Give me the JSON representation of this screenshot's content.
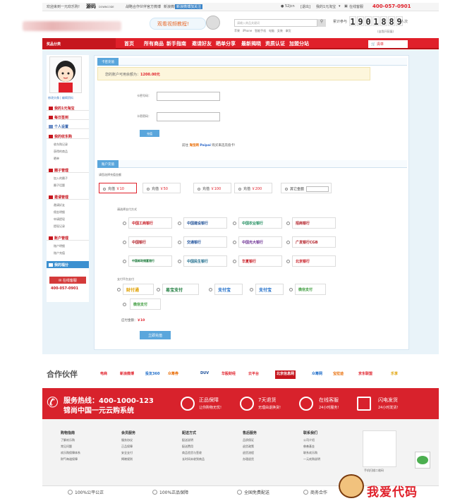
{
  "topbar": {
    "welcome": "欢迎来到一元欢乐购!",
    "brand": "源码",
    "brand_sub": "DOWNCODE",
    "links": [
      "战略合作伙伴",
      "官方微博",
      "新浪微博"
    ],
    "weibo_btn": "新浪微博加关注",
    "user": "52jcn",
    "logout": "[退出]",
    "mine": "我的1元淘宝",
    "service": "在线客服",
    "phone": "400-057-0901"
  },
  "header": {
    "promo": "观看视频教程!",
    "search_placeholder": "请输入商品关键词",
    "hotwords": [
      "苹果",
      "iPhone",
      "智能手机",
      "电脑",
      "女装",
      "拿货"
    ],
    "counter_label": "累计参与",
    "counter_digits": [
      "1",
      "9",
      "0",
      "1",
      "8",
      "8",
      "9"
    ],
    "counter_unit": "人次",
    "counter_note": "(自我开获展)"
  },
  "nav": {
    "category": "奖品分类",
    "items": [
      "首页",
      "所有商品",
      "新手指南",
      "邀请好友",
      "晒单分享",
      "最新揭晓",
      "资质认证",
      "加盟分站"
    ],
    "cart": "清单"
  },
  "sidebar": {
    "avatar_links": [
      "修改头像",
      "编辑资料"
    ],
    "sections": [
      {
        "label": "我的1元淘宝",
        "subs": []
      },
      {
        "label": "每日签到",
        "subs": []
      },
      {
        "label": "个人设置",
        "subs": []
      },
      {
        "label": "我的收东购",
        "subs": [
          "收东购记录",
          "获得的商品",
          "晒单"
        ]
      },
      {
        "label": "圈子管理",
        "subs": [
          "加入的圈子",
          "圈子话题"
        ]
      },
      {
        "label": "邀请管理",
        "subs": [
          "邀请好友",
          "佣金明细",
          "申请提现",
          "提现记录"
        ]
      },
      {
        "label": "账户管理",
        "subs": [
          "账户明细",
          "账户充值"
        ]
      }
    ],
    "active": "我的福分",
    "service_btn": "在线客服",
    "phone": "400-057-0901"
  },
  "card_recharge": {
    "tab": "卡密充值",
    "balance_label": "您的账户可用余额为：",
    "balance_value": "1200.00元",
    "card_no_label": "卡密号码：",
    "card_pwd_label": "卡密密码：",
    "submit": "充值",
    "tip_prefix": "前往",
    "tip_taobao": "淘宝网",
    "tip_paipai": "Paipai",
    "tip_suffix": "购买来选充值卡!"
  },
  "account_recharge": {
    "tab": "账户充值",
    "amount_label": "请您选择充值金额",
    "amounts": [
      {
        "label": "充值",
        "value": "￥10"
      },
      {
        "label": "充值",
        "value": "￥50"
      },
      {
        "label": "充值",
        "value": "￥100"
      },
      {
        "label": "充值",
        "value": "￥200"
      },
      {
        "label": "其它金额",
        "value": ""
      }
    ],
    "pay_method_label": "请选择支付方式",
    "banks": [
      "中国工商银行",
      "中国建设银行",
      "中国农业银行",
      "招商银行",
      "中国银行",
      "交通银行",
      "中国光大银行",
      "广发银行CGB",
      "中国邮政储蓄银行",
      "中国民生银行",
      "华夏银行",
      "北京银行"
    ],
    "platform_label": "支付平台支付",
    "platforms": [
      "财付通",
      "易宝支付",
      "支付宝",
      "支付宝",
      "微信支付",
      "微信支付"
    ],
    "amount_total_label": "应付金额：",
    "amount_total": "￥10",
    "confirm": "立即充值"
  },
  "partners": {
    "title": "合作伙伴",
    "logos": [
      "电商",
      "新浪微博",
      "投友360",
      "众筹券",
      "DUV",
      "华股财经",
      "云平台",
      "北京信息网",
      "众筹网",
      "宝拉迪",
      "京东联盟",
      "乐享"
    ]
  },
  "features": {
    "hotline_title": "服务热线：400-1000-123",
    "hotline_sub": "锦尚中国一元云购系统",
    "items": [
      {
        "title": "正品保障",
        "sub": "让你购物无忧!"
      },
      {
        "title": "7天退货",
        "sub": "无理由退换货!"
      },
      {
        "title": "在线客服",
        "sub": "24小时服务!"
      },
      {
        "title": "闪电发货",
        "sub": "24小时发货!"
      }
    ]
  },
  "footer": {
    "cols": [
      {
        "title": "购物指南",
        "items": [
          "了解欢乐购",
          "常见问题",
          "欢乐购保障体系",
          "财气每道保障"
        ]
      },
      {
        "title": "会员服务",
        "items": [
          "服务协议",
          "正品保障",
          "安全支付",
          "揭晓规则"
        ]
      },
      {
        "title": "配送方式",
        "items": [
          "配送说明",
          "配送费用",
          "商品验货与签收",
          "长时间未收到商品"
        ]
      },
      {
        "title": "售后服务",
        "items": [
          "品质保证",
          "退货政策",
          "退货流程",
          "办理退货"
        ]
      },
      {
        "title": "联系我们",
        "items": [
          "公司介绍",
          "慈善基金",
          "联系欢乐购",
          "一元欢购说明"
        ]
      }
    ],
    "qr_label": "手机扫描二维码"
  },
  "bottombar": {
    "items": [
      "100%公平公正",
      "100%正品保障",
      "全国免费配送",
      "商务合作"
    ],
    "watermark": "我爱代码"
  }
}
